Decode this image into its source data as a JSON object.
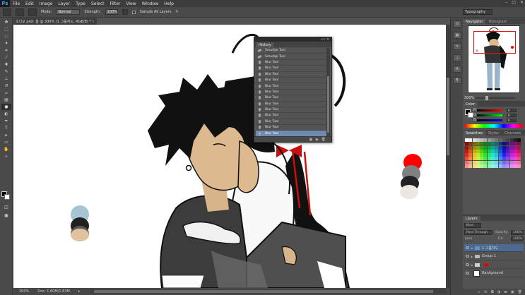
{
  "app": {
    "logo": "Ps"
  },
  "menu": [
    "File",
    "Edit",
    "Image",
    "Layer",
    "Type",
    "Select",
    "Filter",
    "View",
    "Window",
    "Help"
  ],
  "window_controls": {
    "minimize": "–",
    "maximize": "□",
    "close": "✕"
  },
  "options": {
    "mode_label": "Mode:",
    "mode_value": "Normal",
    "strength_label": "Strength:",
    "strength_value": "100%",
    "sample_all_layers": "Sample All Layers",
    "workspace": "Typography"
  },
  "document": {
    "tab_title": "오디오 prof. 홈 @ 300% (1 그룹자드, RGB/8) *",
    "zoom": "300%",
    "doc_info": "Doc: 1.60M/1.83M"
  },
  "history": {
    "title": "History",
    "close": "✕",
    "collapse": "««",
    "items": [
      {
        "label": "Smudge Tool",
        "icon": "smudge-icon"
      },
      {
        "label": "Smudge Tool",
        "icon": "smudge-icon"
      },
      {
        "label": "Blur Tool",
        "icon": "blur-drop-icon"
      },
      {
        "label": "Blur Tool",
        "icon": "blur-drop-icon"
      },
      {
        "label": "Blur Tool",
        "icon": "blur-drop-icon"
      },
      {
        "label": "Blur Tool",
        "icon": "blur-drop-icon"
      },
      {
        "label": "Blur Tool",
        "icon": "blur-drop-icon"
      },
      {
        "label": "Blur Tool",
        "icon": "blur-drop-icon"
      },
      {
        "label": "Blur Tool",
        "icon": "blur-drop-icon"
      },
      {
        "label": "Blur Tool",
        "icon": "blur-drop-icon"
      },
      {
        "label": "Blur Tool",
        "icon": "blur-drop-icon"
      },
      {
        "label": "Blur Tool",
        "icon": "blur-drop-icon"
      },
      {
        "label": "Blur Tool",
        "icon": "blur-drop-icon"
      },
      {
        "label": "Blur Tool",
        "icon": "blur-drop-icon"
      },
      {
        "label": "Blur Tool",
        "icon": "blur-drop-icon"
      }
    ],
    "selected_index": 14
  },
  "navigator": {
    "tabs": [
      "Navigator",
      "Histogram"
    ],
    "zoom": "300%"
  },
  "color": {
    "tabs": [
      "Color"
    ],
    "r_label": "R",
    "g_label": "G",
    "b_label": "B",
    "r": "0",
    "g": "0",
    "b": "0"
  },
  "swatches": {
    "tabs": [
      "Swatches",
      "Styles",
      "Channels"
    ]
  },
  "layers": {
    "tabs": [
      "Layers"
    ],
    "kind": "Kind",
    "blend": "Pass Through",
    "opacity_label": "Opacity:",
    "opacity": "100%",
    "lock_label": "Lock:",
    "fill_label": "Fill:",
    "fill": "100%",
    "items": [
      {
        "name": "1 그룹자드",
        "type": "group",
        "selected": true
      },
      {
        "name": "Group 1",
        "type": "group",
        "selected": false
      },
      {
        "name": "",
        "type": "group-red",
        "selected": false
      },
      {
        "name": "Background",
        "type": "background",
        "selected": false
      }
    ]
  },
  "palette": {
    "fg": "#000000",
    "bg": "#ffffff",
    "canvas_swatches": [
      "#a9c3d6",
      "#202020",
      "#5a5a5a",
      "#e2c19e",
      "#ff0000",
      "#808080",
      "#222222",
      "#ece7df"
    ]
  }
}
